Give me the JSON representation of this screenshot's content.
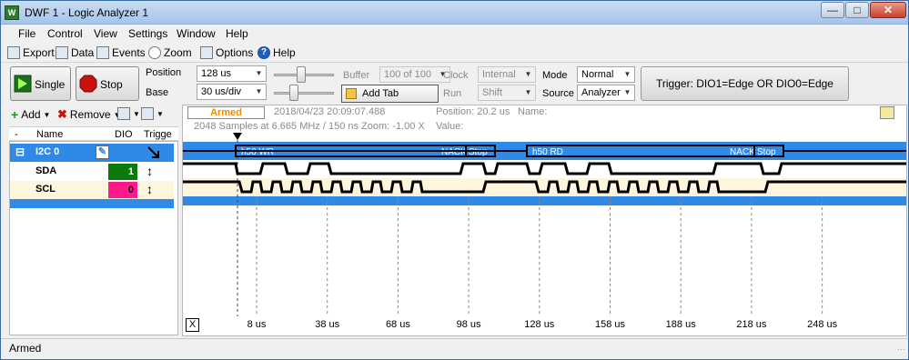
{
  "window": {
    "title": "DWF 1 - Logic Analyzer 1",
    "icon_text": "W"
  },
  "menu": [
    "File",
    "Control",
    "View",
    "Settings",
    "Window",
    "Help"
  ],
  "toolbar": {
    "export": "Export",
    "data": "Data",
    "events": "Events",
    "zoom": "Zoom",
    "options": "Options",
    "help": "Help"
  },
  "controls": {
    "single": "Single",
    "stop": "Stop",
    "position_label": "Position",
    "position_value": "128 us",
    "base_label": "Base",
    "base_value": "30 us/div",
    "buffer_label": "Buffer",
    "buffer_value": "100 of 100",
    "add_tab": "Add Tab",
    "clock_label": "Clock",
    "clock_value": "Internal",
    "run_label": "Run",
    "run_value": "Shift",
    "mode_label": "Mode",
    "mode_value": "Normal",
    "source_label": "Source",
    "source_value": "Analyzer",
    "trigger": "Trigger: DIO1=Edge OR DIO0=Edge",
    "position_slider": 0.45,
    "base_slider": 0.3
  },
  "channels": {
    "add": "Add",
    "remove": "Remove",
    "headers": {
      "expand": "-",
      "name": "Name",
      "dio": "DIO",
      "trigger": "Trigge"
    },
    "bus": {
      "name": "I2C 0",
      "expand": "⊟"
    },
    "rows": [
      {
        "name": "SDA",
        "dio": "1",
        "color": "#0a7a0a"
      },
      {
        "name": "SCL",
        "dio": "0",
        "color": "#ff1a8c"
      }
    ]
  },
  "plot": {
    "state": "Armed",
    "timestamp": "2018/04/23  20:09:07.488",
    "samples": "2048 Samples at 6.665 MHz / 150 ns Zoom: -1.00 X",
    "position": "Position: 20.2 us",
    "name_label": "Name:",
    "value_label": "Value:",
    "x_close": "X",
    "time_ticks": [
      "8 us",
      "38 us",
      "68 us",
      "98 us",
      "128 us",
      "158 us",
      "188 us",
      "218 us",
      "248 us"
    ],
    "frames": [
      {
        "address": "h50 WR",
        "end1": "NACK",
        "end2": "Stop"
      },
      {
        "address": "h50 RD",
        "end1": "NACK",
        "end2": "Stop"
      }
    ],
    "colors": {
      "bus": "#2e8ae6",
      "grid": "#8a8a8a",
      "scl_fill": "#fdf6dc"
    }
  },
  "status": "Armed"
}
